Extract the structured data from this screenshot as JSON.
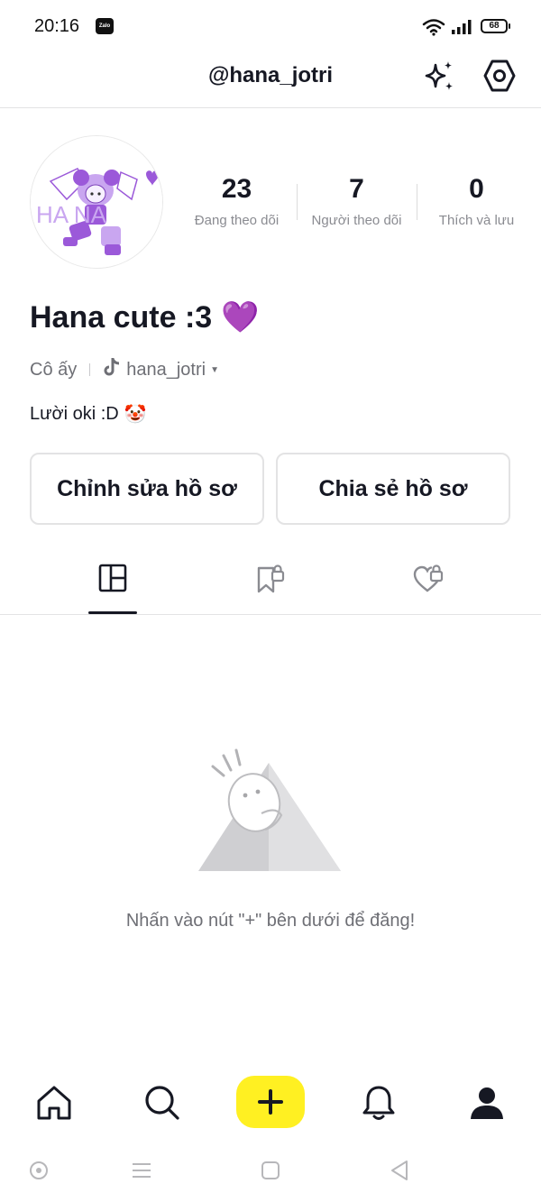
{
  "status_bar": {
    "time": "20:16",
    "notification_app": "Zalo",
    "battery": "68",
    "icons": [
      "zalo-icon",
      "wifi-icon",
      "signal-icon",
      "battery-icon"
    ]
  },
  "header": {
    "username": "@hana_jotri",
    "icons": [
      "sparkle-icon",
      "settings-icon"
    ]
  },
  "avatar": {
    "text": "HA  NA",
    "colors": {
      "purple": "#9b59d9",
      "light_purple": "#c9a6f0"
    }
  },
  "stats": [
    {
      "value": "23",
      "label": "Đang theo dõi"
    },
    {
      "value": "7",
      "label": "Người theo dõi"
    },
    {
      "value": "0",
      "label": "Thích và lưu"
    }
  ],
  "profile": {
    "display_name": "Hana cute :3",
    "name_emoji": "💜",
    "pronouns": "Cô ấy",
    "tiktok_handle": "hana_jotri",
    "bio": "Lười oki :D",
    "bio_emoji": "🤡"
  },
  "actions": {
    "edit_profile": "Chỉnh sửa hồ sơ",
    "share_profile": "Chia sẻ hồ sơ"
  },
  "tabs": [
    {
      "icon": "videos-grid-icon",
      "active": true
    },
    {
      "icon": "saved-locked-icon",
      "active": false
    },
    {
      "icon": "liked-locked-icon",
      "active": false
    }
  ],
  "empty_state": {
    "message": "Nhấn vào nút \"+\" bên dưới để đăng!"
  },
  "bottom_nav": {
    "icons": [
      "home-icon",
      "search-icon",
      "plus-icon",
      "bell-icon",
      "profile-icon"
    ],
    "create_color": "#fff022"
  },
  "system_nav": {
    "icons": [
      "assistant-icon",
      "menu-icon",
      "home-square-icon",
      "back-icon"
    ]
  }
}
